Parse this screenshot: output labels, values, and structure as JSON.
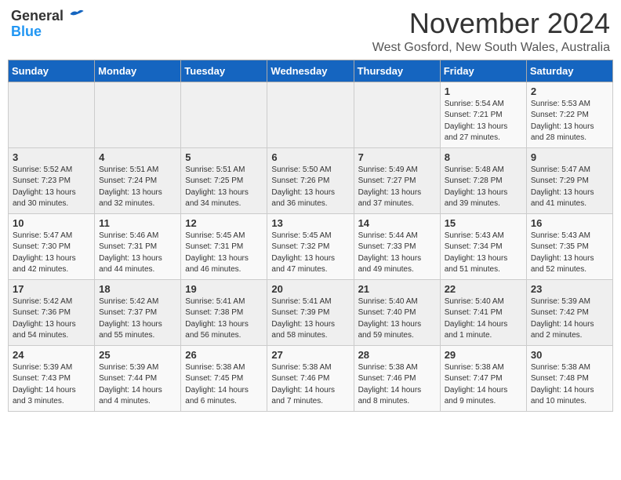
{
  "header": {
    "logo_general": "General",
    "logo_blue": "Blue",
    "month_title": "November 2024",
    "subtitle": "West Gosford, New South Wales, Australia"
  },
  "weekdays": [
    "Sunday",
    "Monday",
    "Tuesday",
    "Wednesday",
    "Thursday",
    "Friday",
    "Saturday"
  ],
  "weeks": [
    [
      {
        "day": "",
        "info": ""
      },
      {
        "day": "",
        "info": ""
      },
      {
        "day": "",
        "info": ""
      },
      {
        "day": "",
        "info": ""
      },
      {
        "day": "",
        "info": ""
      },
      {
        "day": "1",
        "info": "Sunrise: 5:54 AM\nSunset: 7:21 PM\nDaylight: 13 hours and 27 minutes."
      },
      {
        "day": "2",
        "info": "Sunrise: 5:53 AM\nSunset: 7:22 PM\nDaylight: 13 hours and 28 minutes."
      }
    ],
    [
      {
        "day": "3",
        "info": "Sunrise: 5:52 AM\nSunset: 7:23 PM\nDaylight: 13 hours and 30 minutes."
      },
      {
        "day": "4",
        "info": "Sunrise: 5:51 AM\nSunset: 7:24 PM\nDaylight: 13 hours and 32 minutes."
      },
      {
        "day": "5",
        "info": "Sunrise: 5:51 AM\nSunset: 7:25 PM\nDaylight: 13 hours and 34 minutes."
      },
      {
        "day": "6",
        "info": "Sunrise: 5:50 AM\nSunset: 7:26 PM\nDaylight: 13 hours and 36 minutes."
      },
      {
        "day": "7",
        "info": "Sunrise: 5:49 AM\nSunset: 7:27 PM\nDaylight: 13 hours and 37 minutes."
      },
      {
        "day": "8",
        "info": "Sunrise: 5:48 AM\nSunset: 7:28 PM\nDaylight: 13 hours and 39 minutes."
      },
      {
        "day": "9",
        "info": "Sunrise: 5:47 AM\nSunset: 7:29 PM\nDaylight: 13 hours and 41 minutes."
      }
    ],
    [
      {
        "day": "10",
        "info": "Sunrise: 5:47 AM\nSunset: 7:30 PM\nDaylight: 13 hours and 42 minutes."
      },
      {
        "day": "11",
        "info": "Sunrise: 5:46 AM\nSunset: 7:31 PM\nDaylight: 13 hours and 44 minutes."
      },
      {
        "day": "12",
        "info": "Sunrise: 5:45 AM\nSunset: 7:31 PM\nDaylight: 13 hours and 46 minutes."
      },
      {
        "day": "13",
        "info": "Sunrise: 5:45 AM\nSunset: 7:32 PM\nDaylight: 13 hours and 47 minutes."
      },
      {
        "day": "14",
        "info": "Sunrise: 5:44 AM\nSunset: 7:33 PM\nDaylight: 13 hours and 49 minutes."
      },
      {
        "day": "15",
        "info": "Sunrise: 5:43 AM\nSunset: 7:34 PM\nDaylight: 13 hours and 51 minutes."
      },
      {
        "day": "16",
        "info": "Sunrise: 5:43 AM\nSunset: 7:35 PM\nDaylight: 13 hours and 52 minutes."
      }
    ],
    [
      {
        "day": "17",
        "info": "Sunrise: 5:42 AM\nSunset: 7:36 PM\nDaylight: 13 hours and 54 minutes."
      },
      {
        "day": "18",
        "info": "Sunrise: 5:42 AM\nSunset: 7:37 PM\nDaylight: 13 hours and 55 minutes."
      },
      {
        "day": "19",
        "info": "Sunrise: 5:41 AM\nSunset: 7:38 PM\nDaylight: 13 hours and 56 minutes."
      },
      {
        "day": "20",
        "info": "Sunrise: 5:41 AM\nSunset: 7:39 PM\nDaylight: 13 hours and 58 minutes."
      },
      {
        "day": "21",
        "info": "Sunrise: 5:40 AM\nSunset: 7:40 PM\nDaylight: 13 hours and 59 minutes."
      },
      {
        "day": "22",
        "info": "Sunrise: 5:40 AM\nSunset: 7:41 PM\nDaylight: 14 hours and 1 minute."
      },
      {
        "day": "23",
        "info": "Sunrise: 5:39 AM\nSunset: 7:42 PM\nDaylight: 14 hours and 2 minutes."
      }
    ],
    [
      {
        "day": "24",
        "info": "Sunrise: 5:39 AM\nSunset: 7:43 PM\nDaylight: 14 hours and 3 minutes."
      },
      {
        "day": "25",
        "info": "Sunrise: 5:39 AM\nSunset: 7:44 PM\nDaylight: 14 hours and 4 minutes."
      },
      {
        "day": "26",
        "info": "Sunrise: 5:38 AM\nSunset: 7:45 PM\nDaylight: 14 hours and 6 minutes."
      },
      {
        "day": "27",
        "info": "Sunrise: 5:38 AM\nSunset: 7:46 PM\nDaylight: 14 hours and 7 minutes."
      },
      {
        "day": "28",
        "info": "Sunrise: 5:38 AM\nSunset: 7:46 PM\nDaylight: 14 hours and 8 minutes."
      },
      {
        "day": "29",
        "info": "Sunrise: 5:38 AM\nSunset: 7:47 PM\nDaylight: 14 hours and 9 minutes."
      },
      {
        "day": "30",
        "info": "Sunrise: 5:38 AM\nSunset: 7:48 PM\nDaylight: 14 hours and 10 minutes."
      }
    ]
  ]
}
